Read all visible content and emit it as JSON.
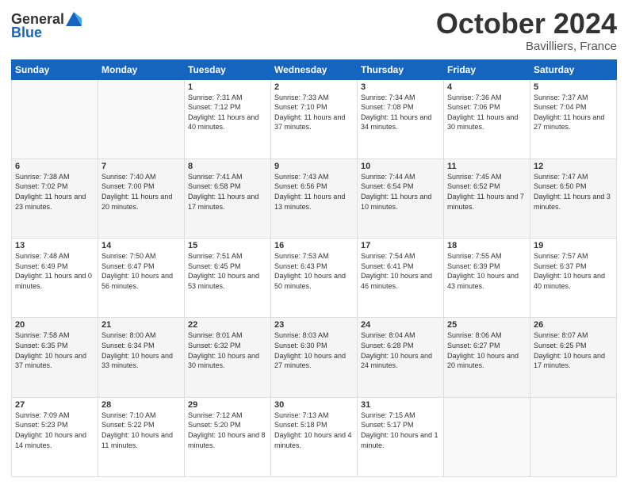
{
  "logo": {
    "general": "General",
    "blue": "Blue"
  },
  "header": {
    "month": "October 2024",
    "location": "Bavilliers, France"
  },
  "days_of_week": [
    "Sunday",
    "Monday",
    "Tuesday",
    "Wednesday",
    "Thursday",
    "Friday",
    "Saturday"
  ],
  "weeks": [
    [
      {
        "day": "",
        "sunrise": "",
        "sunset": "",
        "daylight": ""
      },
      {
        "day": "",
        "sunrise": "",
        "sunset": "",
        "daylight": ""
      },
      {
        "day": "1",
        "sunrise": "Sunrise: 7:31 AM",
        "sunset": "Sunset: 7:12 PM",
        "daylight": "Daylight: 11 hours and 40 minutes."
      },
      {
        "day": "2",
        "sunrise": "Sunrise: 7:33 AM",
        "sunset": "Sunset: 7:10 PM",
        "daylight": "Daylight: 11 hours and 37 minutes."
      },
      {
        "day": "3",
        "sunrise": "Sunrise: 7:34 AM",
        "sunset": "Sunset: 7:08 PM",
        "daylight": "Daylight: 11 hours and 34 minutes."
      },
      {
        "day": "4",
        "sunrise": "Sunrise: 7:36 AM",
        "sunset": "Sunset: 7:06 PM",
        "daylight": "Daylight: 11 hours and 30 minutes."
      },
      {
        "day": "5",
        "sunrise": "Sunrise: 7:37 AM",
        "sunset": "Sunset: 7:04 PM",
        "daylight": "Daylight: 11 hours and 27 minutes."
      }
    ],
    [
      {
        "day": "6",
        "sunrise": "Sunrise: 7:38 AM",
        "sunset": "Sunset: 7:02 PM",
        "daylight": "Daylight: 11 hours and 23 minutes."
      },
      {
        "day": "7",
        "sunrise": "Sunrise: 7:40 AM",
        "sunset": "Sunset: 7:00 PM",
        "daylight": "Daylight: 11 hours and 20 minutes."
      },
      {
        "day": "8",
        "sunrise": "Sunrise: 7:41 AM",
        "sunset": "Sunset: 6:58 PM",
        "daylight": "Daylight: 11 hours and 17 minutes."
      },
      {
        "day": "9",
        "sunrise": "Sunrise: 7:43 AM",
        "sunset": "Sunset: 6:56 PM",
        "daylight": "Daylight: 11 hours and 13 minutes."
      },
      {
        "day": "10",
        "sunrise": "Sunrise: 7:44 AM",
        "sunset": "Sunset: 6:54 PM",
        "daylight": "Daylight: 11 hours and 10 minutes."
      },
      {
        "day": "11",
        "sunrise": "Sunrise: 7:45 AM",
        "sunset": "Sunset: 6:52 PM",
        "daylight": "Daylight: 11 hours and 7 minutes."
      },
      {
        "day": "12",
        "sunrise": "Sunrise: 7:47 AM",
        "sunset": "Sunset: 6:50 PM",
        "daylight": "Daylight: 11 hours and 3 minutes."
      }
    ],
    [
      {
        "day": "13",
        "sunrise": "Sunrise: 7:48 AM",
        "sunset": "Sunset: 6:49 PM",
        "daylight": "Daylight: 11 hours and 0 minutes."
      },
      {
        "day": "14",
        "sunrise": "Sunrise: 7:50 AM",
        "sunset": "Sunset: 6:47 PM",
        "daylight": "Daylight: 10 hours and 56 minutes."
      },
      {
        "day": "15",
        "sunrise": "Sunrise: 7:51 AM",
        "sunset": "Sunset: 6:45 PM",
        "daylight": "Daylight: 10 hours and 53 minutes."
      },
      {
        "day": "16",
        "sunrise": "Sunrise: 7:53 AM",
        "sunset": "Sunset: 6:43 PM",
        "daylight": "Daylight: 10 hours and 50 minutes."
      },
      {
        "day": "17",
        "sunrise": "Sunrise: 7:54 AM",
        "sunset": "Sunset: 6:41 PM",
        "daylight": "Daylight: 10 hours and 46 minutes."
      },
      {
        "day": "18",
        "sunrise": "Sunrise: 7:55 AM",
        "sunset": "Sunset: 6:39 PM",
        "daylight": "Daylight: 10 hours and 43 minutes."
      },
      {
        "day": "19",
        "sunrise": "Sunrise: 7:57 AM",
        "sunset": "Sunset: 6:37 PM",
        "daylight": "Daylight: 10 hours and 40 minutes."
      }
    ],
    [
      {
        "day": "20",
        "sunrise": "Sunrise: 7:58 AM",
        "sunset": "Sunset: 6:35 PM",
        "daylight": "Daylight: 10 hours and 37 minutes."
      },
      {
        "day": "21",
        "sunrise": "Sunrise: 8:00 AM",
        "sunset": "Sunset: 6:34 PM",
        "daylight": "Daylight: 10 hours and 33 minutes."
      },
      {
        "day": "22",
        "sunrise": "Sunrise: 8:01 AM",
        "sunset": "Sunset: 6:32 PM",
        "daylight": "Daylight: 10 hours and 30 minutes."
      },
      {
        "day": "23",
        "sunrise": "Sunrise: 8:03 AM",
        "sunset": "Sunset: 6:30 PM",
        "daylight": "Daylight: 10 hours and 27 minutes."
      },
      {
        "day": "24",
        "sunrise": "Sunrise: 8:04 AM",
        "sunset": "Sunset: 6:28 PM",
        "daylight": "Daylight: 10 hours and 24 minutes."
      },
      {
        "day": "25",
        "sunrise": "Sunrise: 8:06 AM",
        "sunset": "Sunset: 6:27 PM",
        "daylight": "Daylight: 10 hours and 20 minutes."
      },
      {
        "day": "26",
        "sunrise": "Sunrise: 8:07 AM",
        "sunset": "Sunset: 6:25 PM",
        "daylight": "Daylight: 10 hours and 17 minutes."
      }
    ],
    [
      {
        "day": "27",
        "sunrise": "Sunrise: 7:09 AM",
        "sunset": "Sunset: 5:23 PM",
        "daylight": "Daylight: 10 hours and 14 minutes."
      },
      {
        "day": "28",
        "sunrise": "Sunrise: 7:10 AM",
        "sunset": "Sunset: 5:22 PM",
        "daylight": "Daylight: 10 hours and 11 minutes."
      },
      {
        "day": "29",
        "sunrise": "Sunrise: 7:12 AM",
        "sunset": "Sunset: 5:20 PM",
        "daylight": "Daylight: 10 hours and 8 minutes."
      },
      {
        "day": "30",
        "sunrise": "Sunrise: 7:13 AM",
        "sunset": "Sunset: 5:18 PM",
        "daylight": "Daylight: 10 hours and 4 minutes."
      },
      {
        "day": "31",
        "sunrise": "Sunrise: 7:15 AM",
        "sunset": "Sunset: 5:17 PM",
        "daylight": "Daylight: 10 hours and 1 minute."
      },
      {
        "day": "",
        "sunrise": "",
        "sunset": "",
        "daylight": ""
      },
      {
        "day": "",
        "sunrise": "",
        "sunset": "",
        "daylight": ""
      }
    ]
  ]
}
